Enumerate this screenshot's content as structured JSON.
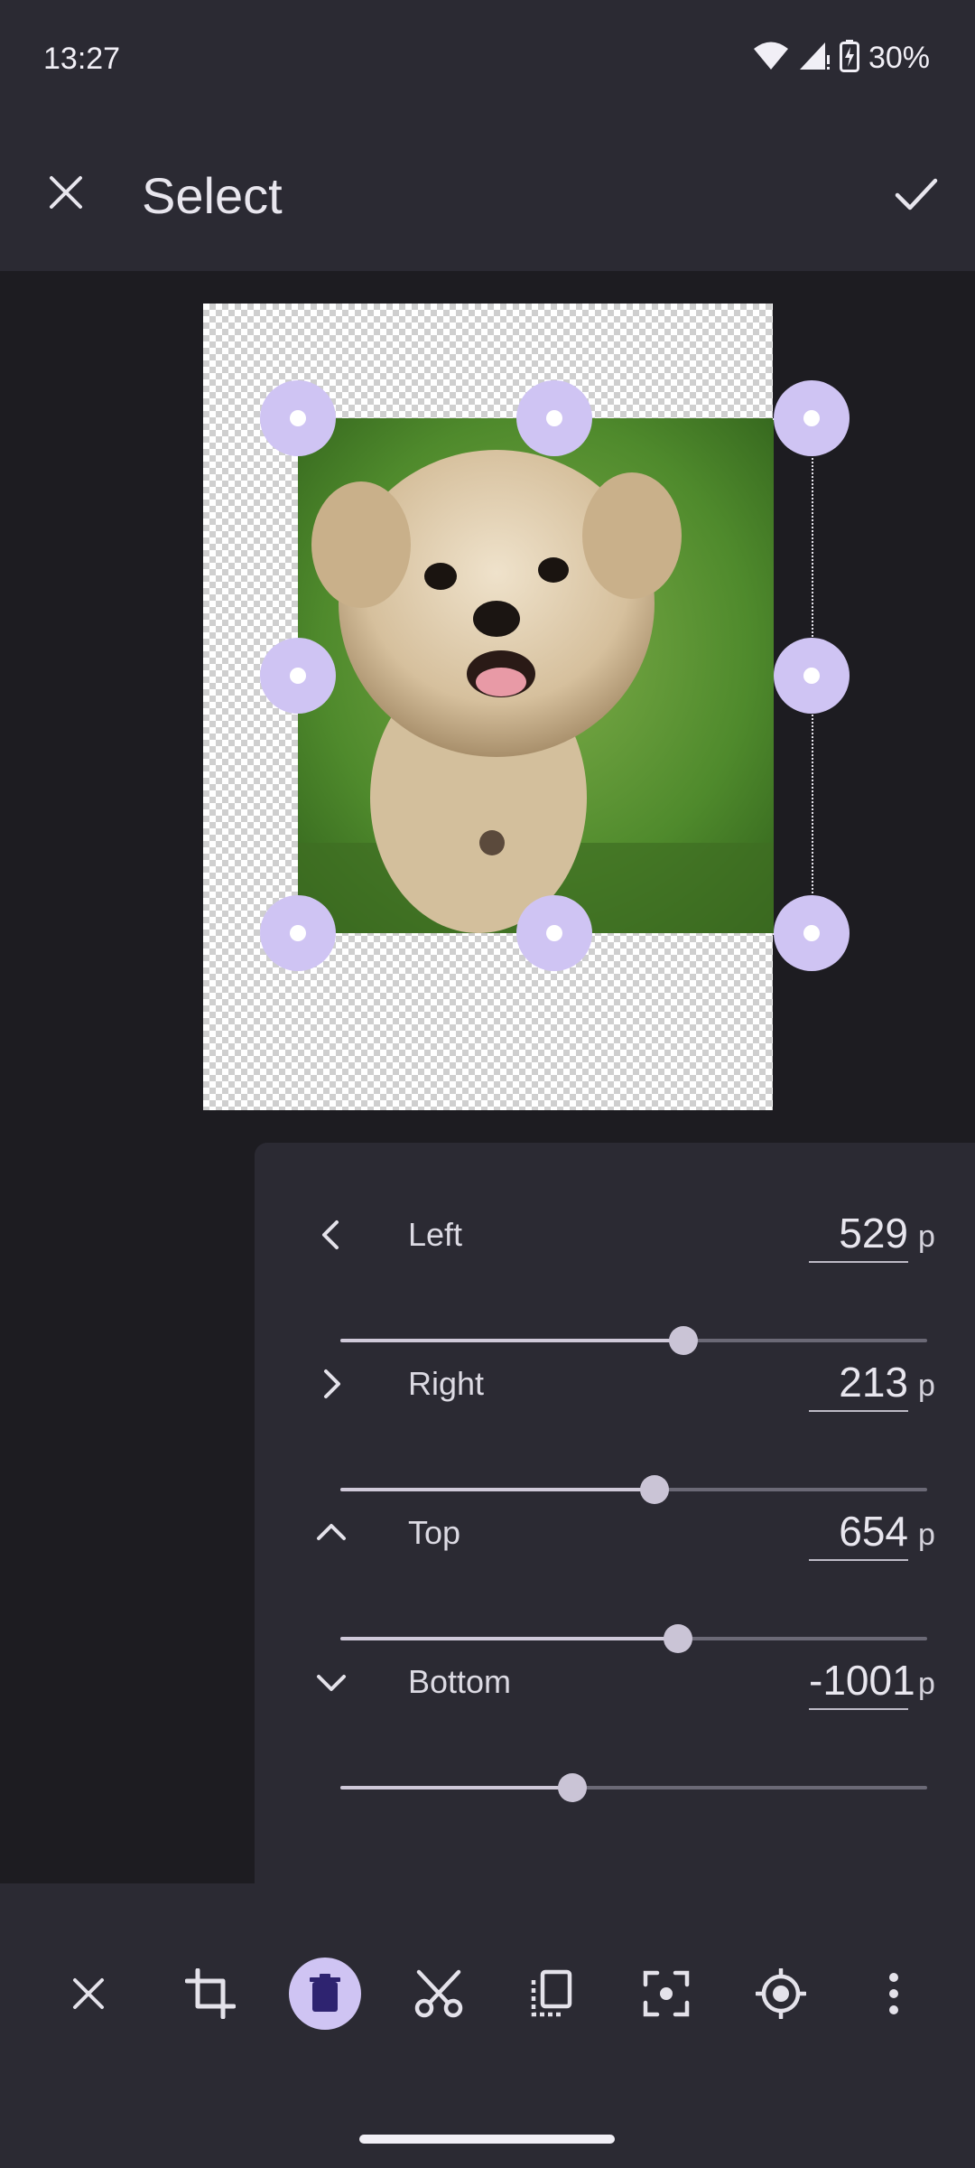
{
  "status_bar": {
    "time": "13:27",
    "battery": "30%"
  },
  "app_bar": {
    "title": "Select"
  },
  "adjust_panel": {
    "rows": [
      {
        "label": "Left",
        "value": "529",
        "unit": "p",
        "slider_fraction": 0.585
      },
      {
        "label": "Right",
        "value": "213",
        "unit": "p",
        "slider_fraction": 0.535
      },
      {
        "label": "Top",
        "value": "654",
        "unit": "p",
        "slider_fraction": 0.575
      },
      {
        "label": "Bottom",
        "value": "-1001",
        "unit": "p",
        "slider_fraction": 0.395
      }
    ]
  },
  "toolbar": {
    "tools": [
      "close-icon",
      "crop-icon",
      "delete-icon",
      "cut-icon",
      "copy-icon",
      "focus-icon",
      "target-icon",
      "more-vertical-icon"
    ],
    "active_tool": "delete-icon"
  },
  "colors": {
    "accent": "#cfc4f3",
    "surface": "#2b2a33",
    "background": "#1d1c21"
  }
}
